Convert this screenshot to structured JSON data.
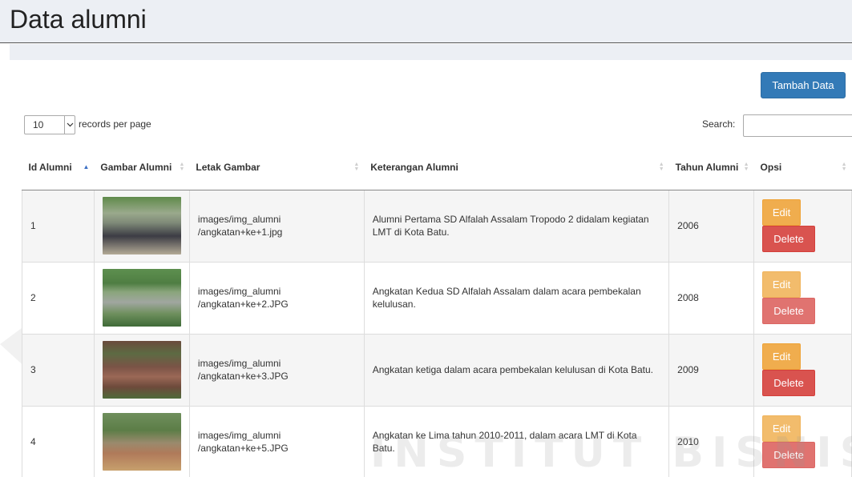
{
  "page": {
    "title": "Data alumni"
  },
  "toolbar": {
    "add_label": "Tambah Data"
  },
  "table_controls": {
    "page_length_value": "10",
    "page_length_label": "records per page",
    "search_label": "Search:",
    "search_value": ""
  },
  "columns": [
    "Id Alumni",
    "Gambar Alumni",
    "Letak Gambar",
    "Keterangan Alumni",
    "Tahun Alumni",
    "Opsi"
  ],
  "rows": [
    {
      "id": "1",
      "path": "images/img_alumni /angkatan+ke+1.jpg",
      "desc": "Alumni Pertama SD Alfalah Assalam Tropodo 2 didalam kegiatan LMT di Kota Batu.",
      "year": "2006",
      "edit": "Edit",
      "delete": "Delete"
    },
    {
      "id": "2",
      "path": "images/img_alumni /angkatan+ke+2.JPG",
      "desc": "Angkatan Kedua SD Alfalah Assalam dalam acara pembekalan kelulusan.",
      "year": "2008",
      "edit": "Edit",
      "delete": "Delete"
    },
    {
      "id": "3",
      "path": "images/img_alumni /angkatan+ke+3.JPG",
      "desc": "Angkatan ketiga dalam acara pembekalan kelulusan di Kota Batu.",
      "year": "2009",
      "edit": "Edit",
      "delete": "Delete"
    },
    {
      "id": "4",
      "path": "images/img_alumni /angkatan+ke+5.JPG",
      "desc": "Angkatan ke Lima tahun 2010-2011, dalam acara LMT di Kota Batu.",
      "year": "2010",
      "edit": "Edit",
      "delete": "Delete"
    }
  ],
  "watermark": {
    "text": "INSTITUT BISNIS"
  },
  "colors": {
    "primary": "#337ab7",
    "warning": "#f0ad4e",
    "danger": "#d9534f",
    "title_bar": "#eceff4",
    "sort_active": "#3b6fc4"
  }
}
